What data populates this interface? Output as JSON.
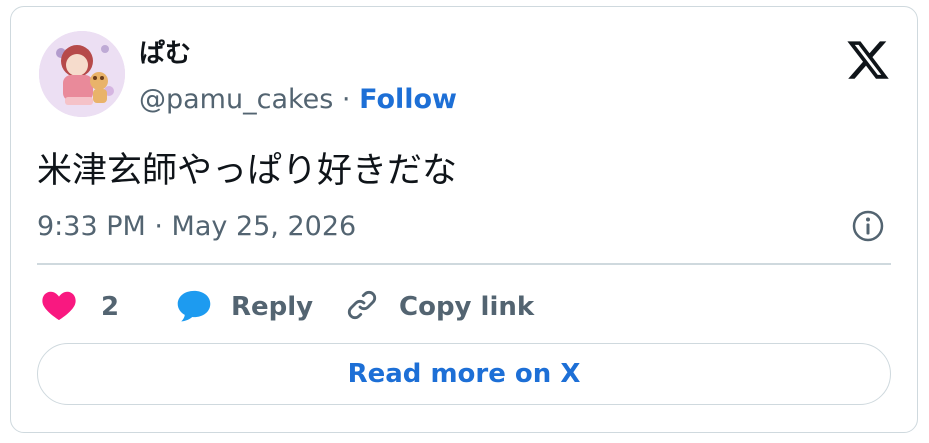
{
  "author": {
    "display_name": "ぱむ",
    "handle": "@pamu_cakes",
    "separator": " · ",
    "follow_label": "Follow"
  },
  "tweet": {
    "text": "米津玄師やっぱり好きだな",
    "timestamp": "9:33 PM · May 25, 2026"
  },
  "actions": {
    "like_count": "2",
    "reply_label": "Reply",
    "copy_link_label": "Copy link"
  },
  "read_more_label": "Read more on X",
  "colors": {
    "accent": "#1d6fd6",
    "like": "#f91880",
    "reply_bubble": "#1d9bf0",
    "muted": "#536471",
    "border": "#cfd9de"
  },
  "icons": [
    "avatar-image",
    "x-logo-icon",
    "info-icon",
    "heart-icon",
    "reply-bubble-icon",
    "link-icon"
  ]
}
